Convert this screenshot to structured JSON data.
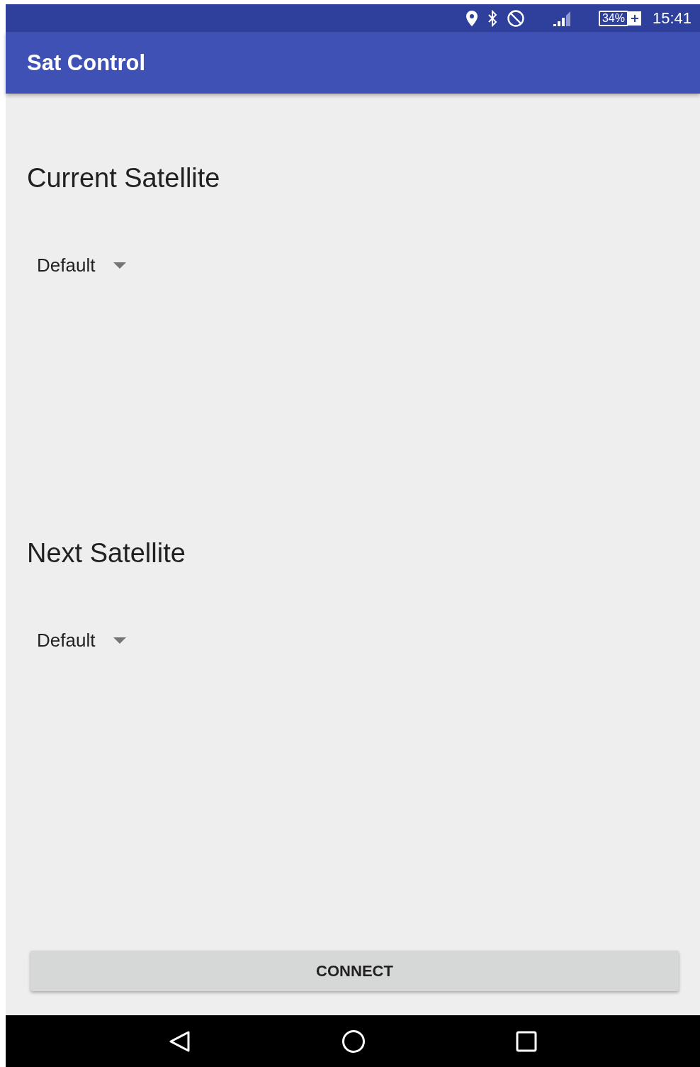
{
  "status_bar": {
    "battery": "34%",
    "charging": true,
    "time": "15:41"
  },
  "app_bar": {
    "title": "Sat Control"
  },
  "sections": [
    {
      "title": "Current Satellite",
      "dropdown": {
        "value": "Default"
      }
    },
    {
      "title": "Next Satellite",
      "dropdown": {
        "value": "Default"
      }
    }
  ],
  "button": {
    "label": "CONNECT"
  }
}
